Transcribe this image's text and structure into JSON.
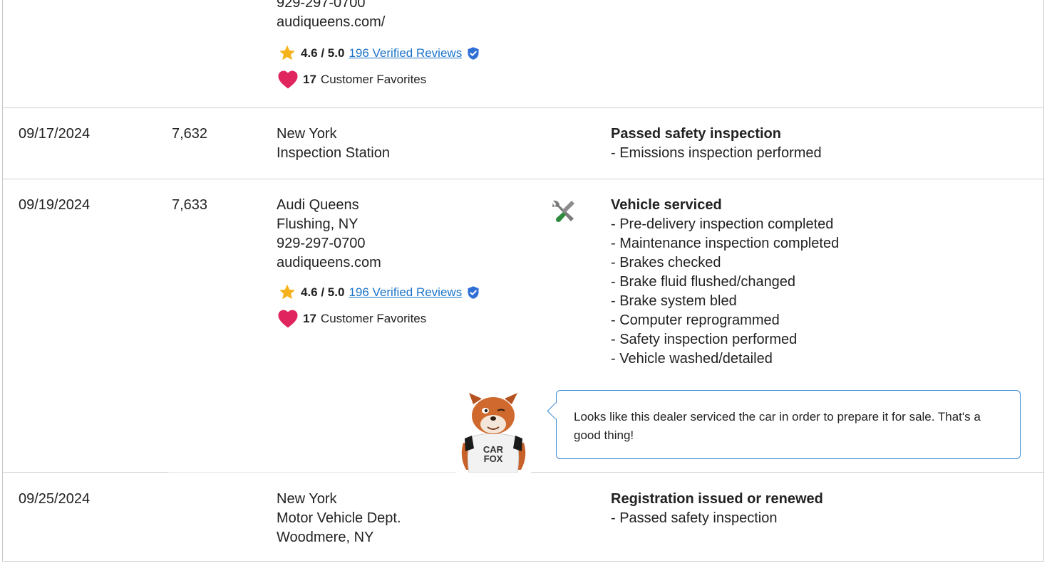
{
  "colors": {
    "link": "#1a73c8",
    "star": "#f5b21b",
    "heart": "#e0245e",
    "verified": "#2f6fd6",
    "bubble_border": "#3d8ad6",
    "wrench_green": "#2e8b3e"
  },
  "records": [
    {
      "date": "",
      "mileage": "",
      "source_lines": [
        "929-297-0700",
        "audiqueens.com/"
      ],
      "rating": "4.6 / 5.0",
      "reviews_link": "196 Verified Reviews",
      "favorites_count": "17",
      "favorites_label": "Customer Favorites"
    },
    {
      "date": "09/17/2024",
      "mileage": "7,632",
      "source_lines": [
        "New York",
        "Inspection Station"
      ],
      "comment_title": "Passed safety inspection",
      "details": [
        "Emissions inspection performed"
      ]
    },
    {
      "date": "09/19/2024",
      "mileage": "7,633",
      "source_lines": [
        "Audi Queens",
        "Flushing, NY",
        "929-297-0700",
        "audiqueens.com"
      ],
      "rating": "4.6 / 5.0",
      "reviews_link": "196 Verified Reviews",
      "favorites_count": "17",
      "favorites_label": "Customer Favorites",
      "icon": "wrench-screwdriver-icon",
      "comment_title": "Vehicle serviced",
      "details": [
        "Pre-delivery inspection completed",
        "Maintenance inspection completed",
        "Brakes checked",
        "Brake fluid flushed/changed",
        "Brake system bled",
        "Computer reprogrammed",
        "Safety inspection performed",
        "Vehicle washed/detailed"
      ],
      "mascot_shirt_line1": "CAR",
      "mascot_shirt_line2": "FOX",
      "tip": "Looks like this dealer serviced the car in order to prepare it for sale. That's a good thing!"
    },
    {
      "date": "09/25/2024",
      "mileage": "",
      "source_lines": [
        "New York",
        "Motor Vehicle Dept.",
        "Woodmere, NY"
      ],
      "comment_title": "Registration issued or renewed",
      "details": [
        "Passed safety inspection"
      ]
    }
  ]
}
